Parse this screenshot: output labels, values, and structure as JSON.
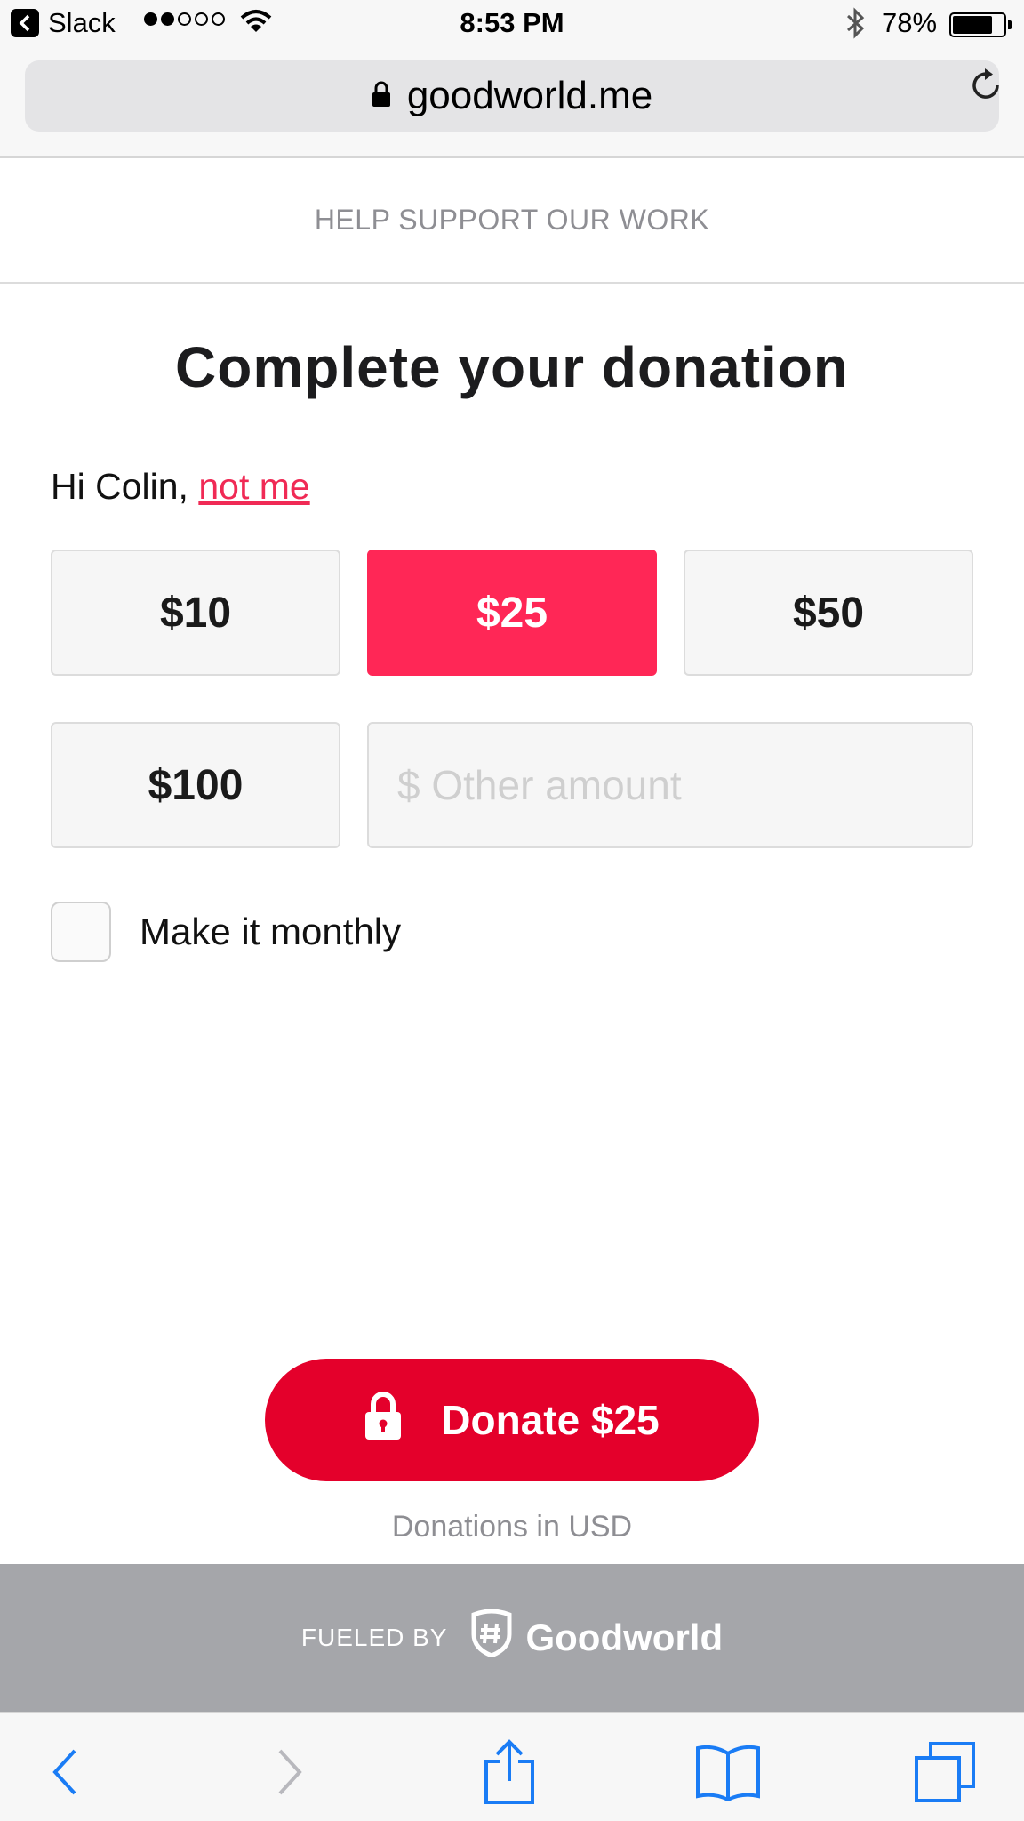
{
  "status_bar": {
    "back_app": "Slack",
    "time": "8:53 PM",
    "battery_percent": "78%",
    "battery_level": 0.78,
    "signal_bars_filled": 2,
    "signal_bars_total": 5
  },
  "browser": {
    "url": "goodworld.me"
  },
  "page": {
    "header": "HELP SUPPORT OUR WORK",
    "title": "Complete your donation",
    "greeting": "Hi Colin,",
    "not_me_link": "not me",
    "amounts": [
      "$10",
      "$25",
      "$50",
      "$100"
    ],
    "selected_amount": "$25",
    "other_amount_placeholder": "$ Other amount",
    "monthly_label": "Make it monthly",
    "monthly_checked": false,
    "donate_button": "Donate $25",
    "currency_note": "Donations in USD"
  },
  "footer": {
    "fueled_by": "FUELED BY",
    "brand": "Goodworld"
  },
  "colors": {
    "accent": "#ff2756",
    "donate": "#e4002b",
    "link": "#f02a55",
    "footer_bg": "#a5a6aa",
    "ios_blue": "#1a7cf5"
  }
}
